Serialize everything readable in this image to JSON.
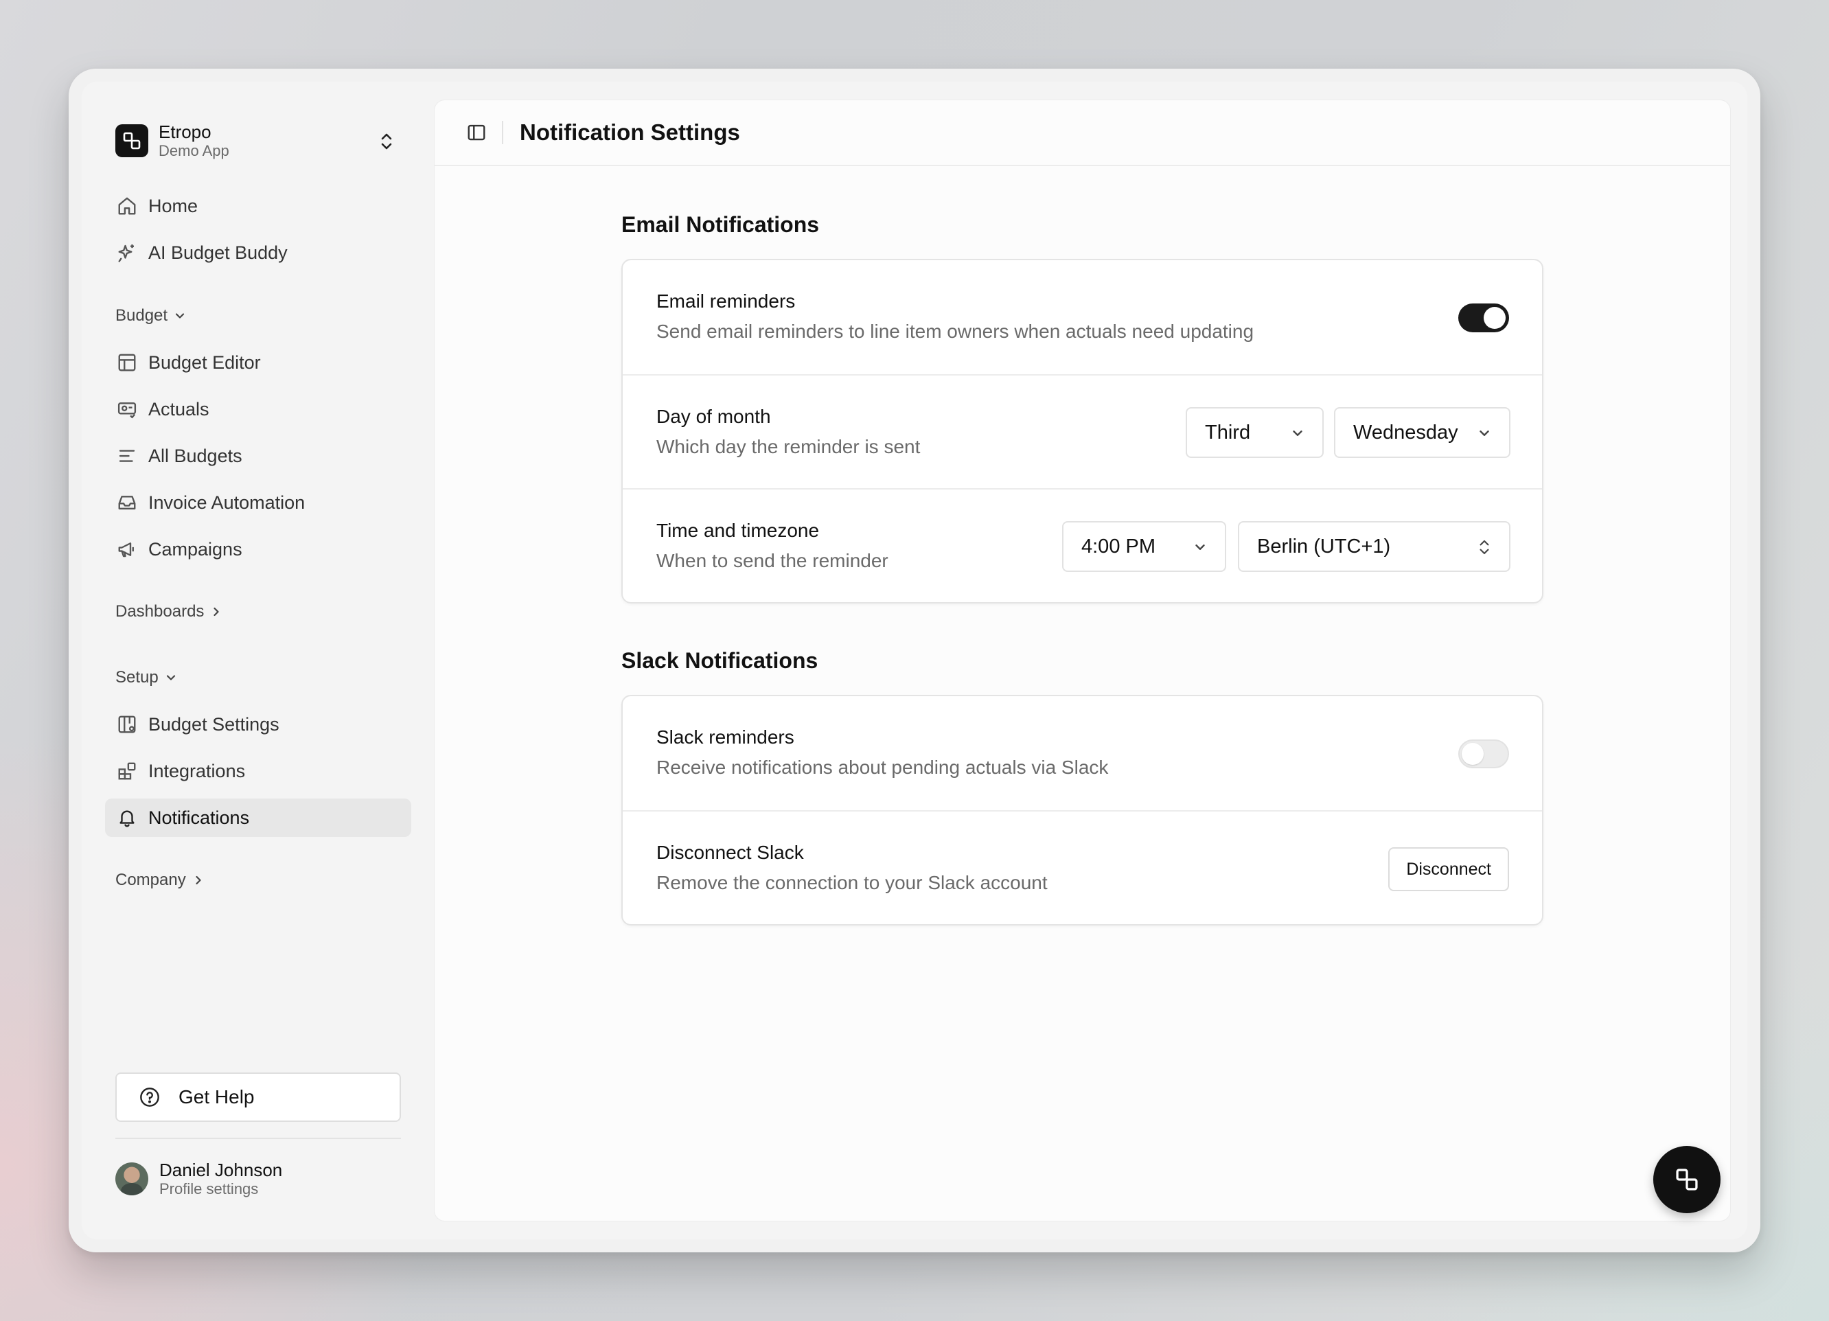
{
  "app": {
    "name": "Etropo",
    "subtitle": "Demo App"
  },
  "sidebar": {
    "top_items": [
      {
        "label": "Home",
        "icon": "home-icon"
      },
      {
        "label": "AI Budget Buddy",
        "icon": "sparkles-icon"
      }
    ],
    "groups": {
      "budget": {
        "label": "Budget",
        "expanded": true,
        "items": [
          {
            "label": "Budget Editor",
            "icon": "table-icon"
          },
          {
            "label": "Actuals",
            "icon": "receipt-icon"
          },
          {
            "label": "All Budgets",
            "icon": "list-icon"
          },
          {
            "label": "Invoice Automation",
            "icon": "inbox-icon"
          },
          {
            "label": "Campaigns",
            "icon": "megaphone-icon"
          }
        ]
      },
      "dashboards": {
        "label": "Dashboards",
        "expanded": false
      },
      "setup": {
        "label": "Setup",
        "expanded": true,
        "items": [
          {
            "label": "Budget Settings",
            "icon": "columns-settings-icon"
          },
          {
            "label": "Integrations",
            "icon": "blocks-icon"
          },
          {
            "label": "Notifications",
            "icon": "bell-icon",
            "active": true
          }
        ]
      },
      "company": {
        "label": "Company",
        "expanded": false
      }
    },
    "help_label": "Get Help",
    "user": {
      "name": "Daniel Johnson",
      "subtitle": "Profile settings"
    }
  },
  "header": {
    "title": "Notification Settings"
  },
  "email": {
    "section_title": "Email Notifications",
    "reminders": {
      "title": "Email reminders",
      "description": "Send email reminders to line item owners when actuals need updating",
      "enabled": true
    },
    "day_of_month": {
      "title": "Day of month",
      "description": "Which day the reminder is sent",
      "week_value": "Third",
      "weekday_value": "Wednesday"
    },
    "time": {
      "title": "Time and timezone",
      "description": "When to send the reminder",
      "time_value": "4:00 PM",
      "timezone_value": "Berlin (UTC+1)"
    }
  },
  "slack": {
    "section_title": "Slack Notifications",
    "reminders": {
      "title": "Slack reminders",
      "description": "Receive notifications about pending actuals via Slack",
      "enabled": false
    },
    "disconnect": {
      "title": "Disconnect Slack",
      "description": "Remove the connection to your Slack account",
      "button_label": "Disconnect"
    }
  },
  "colors": {
    "accent": "#111111",
    "muted_text": "#6a6a6a",
    "active_nav_bg": "#e7e7e7"
  }
}
